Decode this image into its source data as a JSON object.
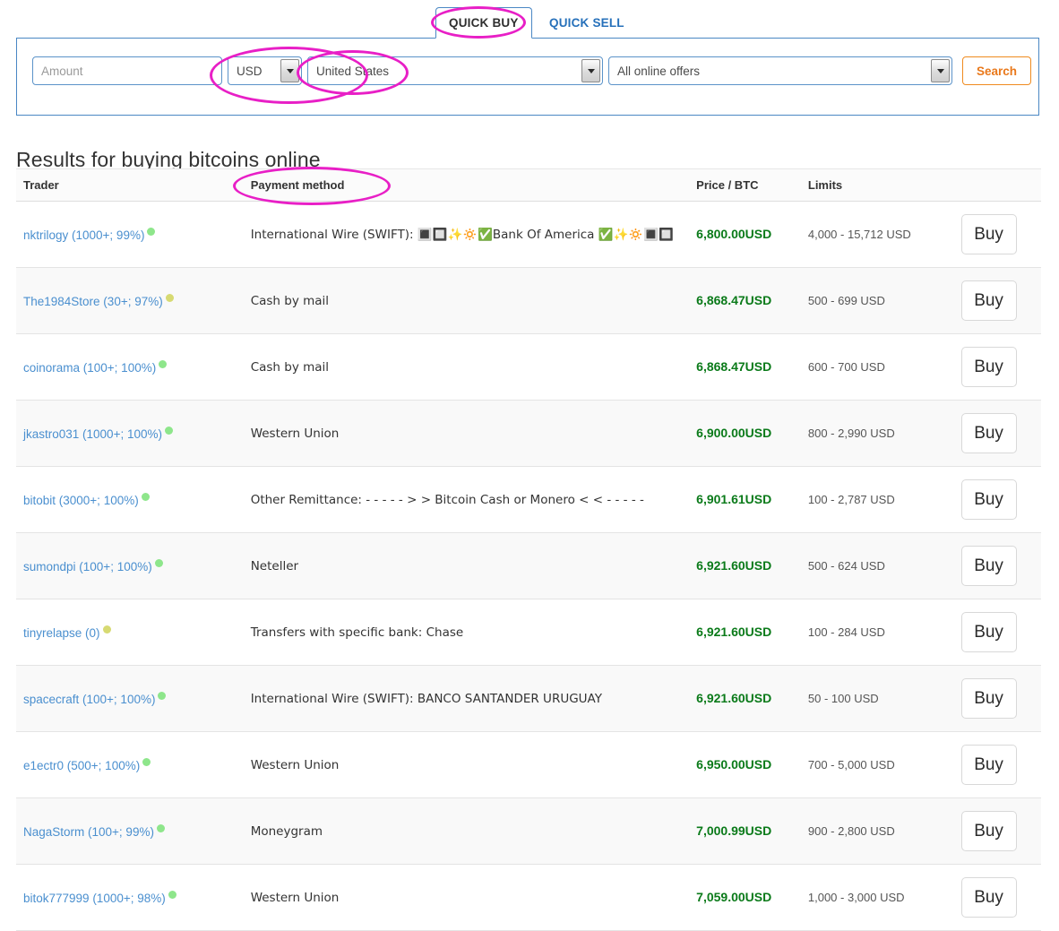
{
  "tabs": [
    {
      "label": "QUICK BUY",
      "active": true
    },
    {
      "label": "QUICK SELL",
      "active": false
    }
  ],
  "search": {
    "amount_value": "",
    "amount_placeholder": "Amount",
    "currency_selected": "USD",
    "country_selected": "United States",
    "offers_selected": "All online offers",
    "search_button_label": "Search"
  },
  "results": {
    "title": "Results for buying bitcoins online",
    "columns": [
      "Trader",
      "Payment method",
      "Price / BTC",
      "Limits",
      ""
    ],
    "buy_label": "Buy",
    "currency_suffix": "USD",
    "rows": [
      {
        "trader": "nktrilogy (1000+; 99%)",
        "status": "online",
        "method": "International Wire (SWIFT): 🔳🔲✨🔅✅Bank Of America ✅✨🔅🔳🔲",
        "price": "6,800.00",
        "currency": "USD",
        "limits": "4,000 - 15,712 USD"
      },
      {
        "trader": "The1984Store (30+; 97%)",
        "status": "away",
        "method": "Cash by mail",
        "price": "6,868.47",
        "currency": "USD",
        "limits": "500 - 699 USD"
      },
      {
        "trader": "coinorama (100+; 100%)",
        "status": "online",
        "method": "Cash by mail",
        "price": "6,868.47",
        "currency": "USD",
        "limits": "600 - 700 USD"
      },
      {
        "trader": "jkastro031 (1000+; 100%)",
        "status": "online",
        "method": "Western Union",
        "price": "6,900.00",
        "currency": "USD",
        "limits": "800 - 2,990 USD"
      },
      {
        "trader": "bitobit (3000+; 100%)",
        "status": "online",
        "method": "Other Remittance: - - - - - > > Bitcoin Cash or Monero < < - - - - -",
        "price": "6,901.61",
        "currency": "USD",
        "limits": "100 - 2,787 USD"
      },
      {
        "trader": "sumondpi (100+; 100%)",
        "status": "online",
        "method": "Neteller",
        "price": "6,921.60",
        "currency": "USD",
        "limits": "500 - 624 USD"
      },
      {
        "trader": "tinyrelapse (0)",
        "status": "away",
        "method": "Transfers with specific bank: Chase",
        "price": "6,921.60",
        "currency": "USD",
        "limits": "100 - 284 USD"
      },
      {
        "trader": "spacecraft (100+; 100%)",
        "status": "online",
        "method": "International Wire (SWIFT): BANCO SANTANDER URUGUAY",
        "price": "6,921.60",
        "currency": "USD",
        "limits": "50 - 100 USD"
      },
      {
        "trader": "e1ectr0 (500+; 100%)",
        "status": "online",
        "method": "Western Union",
        "price": "6,950.00",
        "currency": "USD",
        "limits": "700 - 5,000 USD"
      },
      {
        "trader": "NagaStorm (100+; 99%)",
        "status": "online",
        "method": "Moneygram",
        "price": "7,000.99",
        "currency": "USD",
        "limits": "900 - 2,800 USD"
      },
      {
        "trader": "bitok777999 (1000+; 98%)",
        "status": "online",
        "method": "Western Union",
        "price": "7,059.00",
        "currency": "USD",
        "limits": "1,000 - 3,000 USD"
      }
    ]
  },
  "annotations": {
    "color": "#e81fc6",
    "highlights": [
      "QUICK BUY tab",
      "USD currency select",
      "United States country select",
      "Payment method column header"
    ]
  },
  "colors": {
    "tab_active_text": "#2f2f2f",
    "tab_link": "#2670ba",
    "panel_border": "#4a87c4",
    "search_button": "#e9781a",
    "price_green": "#0a7a19",
    "trader_link": "#4a8fcf",
    "status_online": "#8ee68b",
    "status_away": "#d7da72"
  }
}
